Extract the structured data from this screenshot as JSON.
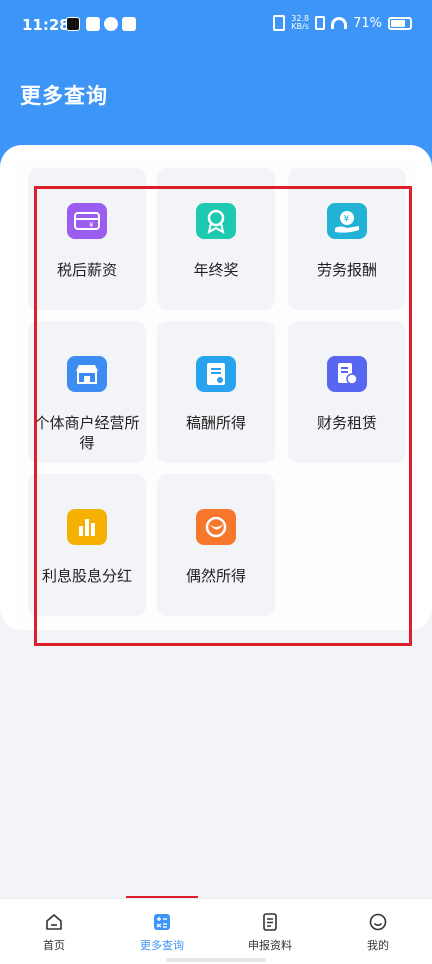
{
  "status_bar": {
    "time": "11:28",
    "net_speed_value": "32.8",
    "net_speed_unit": "KB/s",
    "battery": "71%"
  },
  "header": {
    "title": "更多查询"
  },
  "grid": {
    "items": [
      {
        "label": "税后薪资",
        "icon": "salary-card-icon",
        "color": "#9b5cf0"
      },
      {
        "label": "年终奖",
        "icon": "award-ribbon-icon",
        "color": "#1fc9b0"
      },
      {
        "label": "劳务报酬",
        "icon": "coin-hand-icon",
        "color": "#21b2d6"
      },
      {
        "label": "个体商户经营所得",
        "icon": "storefront-icon",
        "color": "#3d8cf2"
      },
      {
        "label": "稿酬所得",
        "icon": "manuscript-icon",
        "color": "#2aa3ee"
      },
      {
        "label": "财务租赁",
        "icon": "lease-document-icon",
        "color": "#5767f2"
      },
      {
        "label": "利息股息分红",
        "icon": "bar-chart-icon",
        "color": "#f6b000"
      },
      {
        "label": "偶然所得",
        "icon": "lucky-ball-icon",
        "color": "#f7772c"
      }
    ]
  },
  "tabbar": {
    "tabs": [
      {
        "label": "首页",
        "icon": "home-icon",
        "active": false
      },
      {
        "label": "更多查询",
        "icon": "calculator-icon",
        "active": true
      },
      {
        "label": "申报资料",
        "icon": "document-icon",
        "active": false
      },
      {
        "label": "我的",
        "icon": "smiley-icon",
        "active": false
      }
    ]
  },
  "colors": {
    "brand": "#3d96f7",
    "highlight": "#dc1f2b",
    "background": "#f3f4f8"
  }
}
